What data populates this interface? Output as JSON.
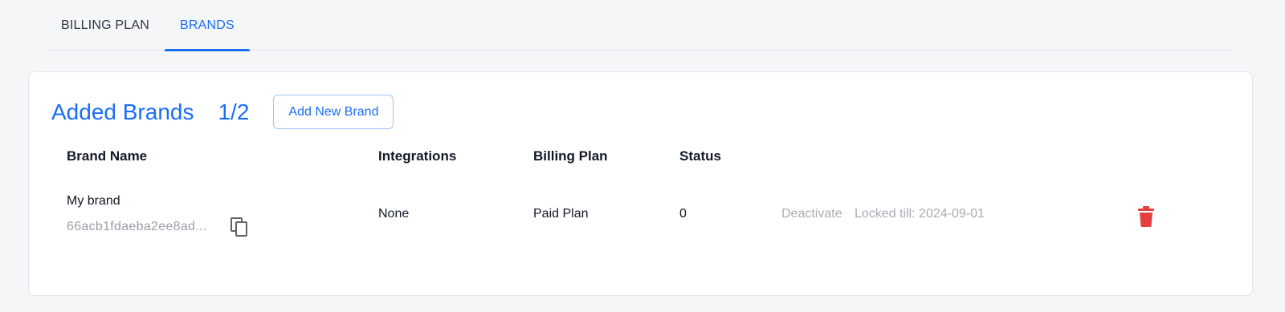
{
  "tabs": [
    {
      "label": "BILLING PLAN",
      "active": false
    },
    {
      "label": "BRANDS",
      "active": true
    }
  ],
  "card": {
    "title": "Added Brands",
    "count": "1/2",
    "add_button_label": "Add New Brand"
  },
  "table": {
    "headers": {
      "brand_name": "Brand Name",
      "integrations": "Integrations",
      "billing_plan": "Billing Plan",
      "status": "Status"
    },
    "rows": [
      {
        "brand_name": "My brand",
        "brand_id": "66acb1fdaeba2ee8ad...",
        "integrations": "None",
        "billing_plan": "Paid Plan",
        "status": "0",
        "deactivate_label": "Deactivate",
        "locked_label": "Locked till: 2024-09-01"
      }
    ]
  },
  "colors": {
    "accent": "#1a6ef5",
    "danger": "#e53e3e",
    "muted": "#a7acb2"
  },
  "icons": {
    "copy": "copy-icon",
    "delete": "trash-icon"
  }
}
